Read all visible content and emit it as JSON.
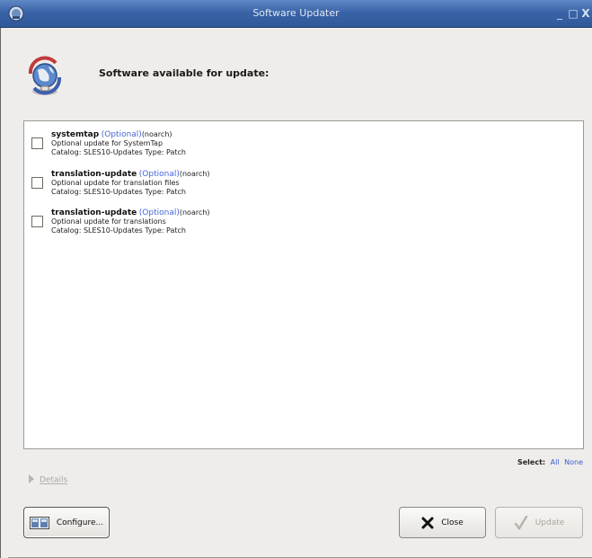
{
  "window": {
    "title": "Software Updater",
    "minimize": "_",
    "maximize": "□",
    "close": "X"
  },
  "header": {
    "text": "Software available for update:"
  },
  "packages": [
    {
      "name": "systemtap",
      "optional": "(Optional)",
      "arch": "(noarch)",
      "description": "Optional update for SystemTap",
      "catalog": "Catalog: SLES10-Updates Type: Patch",
      "checked": false
    },
    {
      "name": "translation-update",
      "optional": "(Optional)",
      "arch": "(noarch)",
      "description": "Optional update for translation files",
      "catalog": "Catalog: SLES10-Updates Type: Patch",
      "checked": false
    },
    {
      "name": "translation-update",
      "optional": "(Optional)",
      "arch": "(noarch)",
      "description": "Optional update for translations",
      "catalog": "Catalog: SLES10-Updates Type: Patch",
      "checked": false
    }
  ],
  "select": {
    "label": "Select:",
    "all": "All",
    "none": "None"
  },
  "details": {
    "label": "Details"
  },
  "buttons": {
    "configure": {
      "label": "Configure...",
      "icon": "configure-icon"
    },
    "close": {
      "label": "Close",
      "icon": "x-icon"
    },
    "update": {
      "label": "Update",
      "icon": "checkmark-icon",
      "enabled": false
    }
  }
}
